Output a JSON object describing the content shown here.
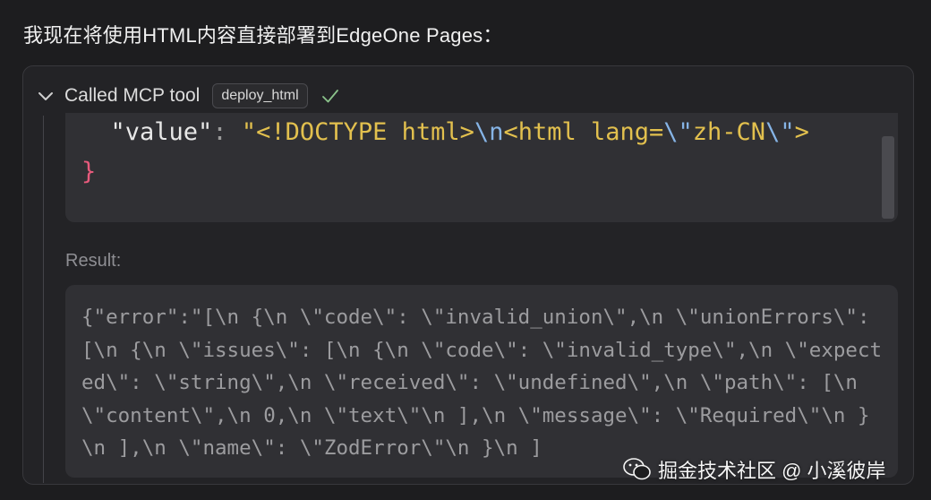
{
  "message": "我现在将使用HTML内容直接部署到EdgeOne Pages：",
  "tool_call": {
    "title": "Called MCP tool",
    "tool_name": "deploy_html",
    "status_icon": "check-icon"
  },
  "code": {
    "line1_key": "\"value\"",
    "line1_colon": ": ",
    "line1_q": "\"",
    "line1_a": "<!DOCTYPE html>",
    "line1_esc1": "\\n",
    "line1_b": "<html lang=",
    "line1_esc2": "\\\"",
    "line1_c": "zh-CN",
    "line1_esc3": "\\\"",
    "line1_d": ">",
    "line2": "}"
  },
  "result": {
    "label": "Result:",
    "text": "{\"error\":\"[\\n {\\n \\\"code\\\": \\\"invalid_union\\\",\\n \\\"unionErrors\\\": [\\n {\\n \\\"issues\\\": [\\n {\\n \\\"code\\\": \\\"invalid_type\\\",\\n \\\"expected\\\": \\\"string\\\",\\n \\\"received\\\": \\\"undefined\\\",\\n \\\"path\\\": [\\n \\\"content\\\",\\n 0,\\n \\\"text\\\"\\n ],\\n \\\"message\\\": \\\"Required\\\"\\n }\\n ],\\n \\\"name\\\": \\\"ZodError\\\"\\n }\\n ]"
  },
  "watermark": "掘金技术社区 @ 小溪彼岸"
}
